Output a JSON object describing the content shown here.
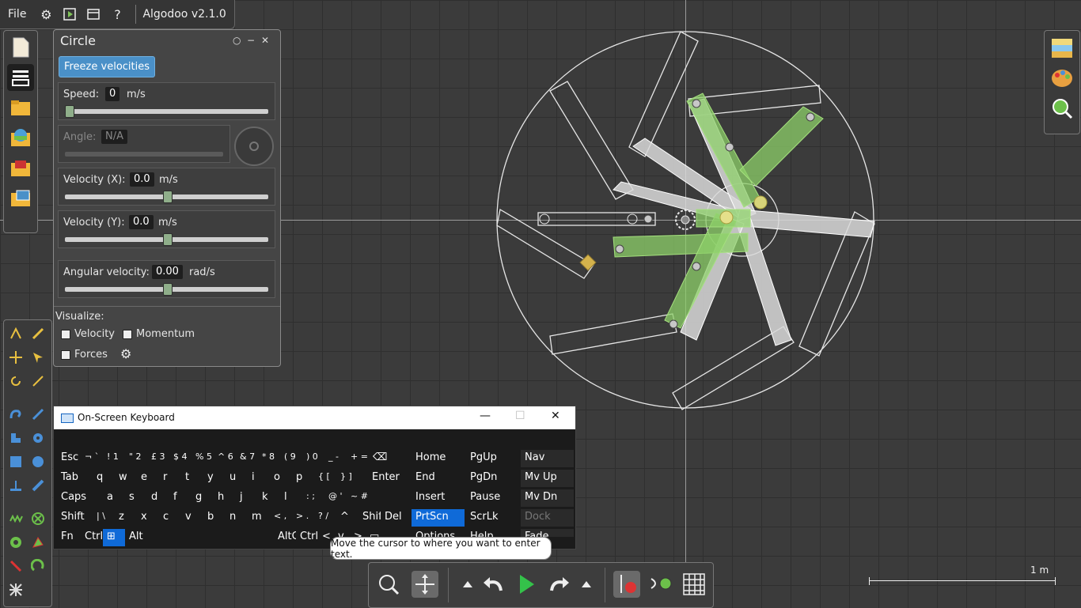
{
  "app": {
    "file_menu": "File",
    "version": "Algodoo v2.1.0"
  },
  "panel": {
    "title": "Circle",
    "freeze_label": "Freeze velocities",
    "speed": {
      "label": "Speed:",
      "value": "0",
      "unit": "m/s",
      "slider": 0.0
    },
    "angle": {
      "label": "Angle:",
      "value": "N/A"
    },
    "velocity_x": {
      "label": "Velocity (X):",
      "value": "0.0",
      "unit": "m/s",
      "slider": 0.5
    },
    "velocity_y": {
      "label": "Velocity (Y):",
      "value": "0.0",
      "unit": "m/s",
      "slider": 0.5
    },
    "angular_velocity": {
      "label": "Angular velocity:",
      "value": "0.00",
      "unit": "rad/s",
      "slider": 0.5
    },
    "visualize": {
      "label": "Visualize:",
      "velocity": "Velocity",
      "momentum": "Momentum",
      "forces": "Forces"
    }
  },
  "scale": {
    "label": "1 m"
  },
  "osk": {
    "title": "On-Screen Keyboard",
    "tooltip": "Move the cursor to where you want to enter text.",
    "rows": [
      [
        "Esc",
        "¬ `",
        "! 1",
        "\" 2",
        "£ 3",
        "$ 4",
        "% 5",
        "^ 6",
        "& 7",
        "* 8",
        "( 9",
        ") 0",
        "_ -",
        "+ =",
        "⌫"
      ],
      [
        "Tab",
        "q",
        "w",
        "e",
        "r",
        "t",
        "y",
        "u",
        "i",
        "o",
        "p",
        "{ [",
        "} ]",
        "Enter"
      ],
      [
        "Caps",
        "a",
        "s",
        "d",
        "f",
        "g",
        "h",
        "j",
        "k",
        "l",
        ": ;",
        "@ '",
        "~ #"
      ],
      [
        "Shift",
        "| \\",
        "z",
        "x",
        "c",
        "v",
        "b",
        "n",
        "m",
        "< ,",
        "> .",
        "? /",
        "^",
        "Shift",
        "Del"
      ],
      [
        "Fn",
        "Ctrl",
        "Win",
        "Alt",
        "",
        "AltGr",
        "Ctrl",
        "<",
        "v",
        ">",
        "▭"
      ]
    ],
    "nav": [
      [
        "Home",
        "PgUp",
        "Nav"
      ],
      [
        "End",
        "PgDn",
        "Mv Up"
      ],
      [
        "Insert",
        "Pause",
        "Mv Dn"
      ],
      [
        "PrtScn",
        "ScrLk",
        "Dock"
      ],
      [
        "Options",
        "Help",
        "Fade"
      ]
    ]
  },
  "colors": {
    "accent": "#4a90c8",
    "osk_highlight": "#0f6ad8",
    "green_body": "#7fc257",
    "gray_body": "#d8d8d8"
  }
}
